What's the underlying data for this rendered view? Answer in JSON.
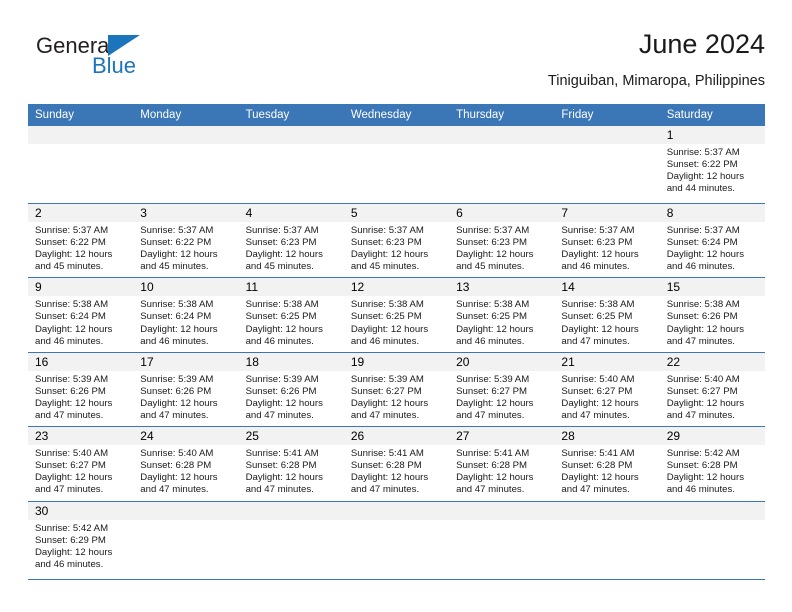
{
  "brand": {
    "name_part1": "General",
    "name_part2": "Blue",
    "triangle_color": "#1b75bc"
  },
  "header": {
    "title": "June 2024",
    "subtitle": "Tiniguiban, Mimaropa, Philippines"
  },
  "theme": {
    "header_blue": "#3b76b6",
    "day_band_gray": "#f2f2f2",
    "text_black": "#1a1a1a"
  },
  "calendar": {
    "weekdays": [
      "Sunday",
      "Monday",
      "Tuesday",
      "Wednesday",
      "Thursday",
      "Friday",
      "Saturday"
    ],
    "weeks": [
      [
        {
          "day": "",
          "empty": true
        },
        {
          "day": "",
          "empty": true
        },
        {
          "day": "",
          "empty": true
        },
        {
          "day": "",
          "empty": true
        },
        {
          "day": "",
          "empty": true
        },
        {
          "day": "",
          "empty": true
        },
        {
          "day": "1",
          "sunrise": "Sunrise: 5:37 AM",
          "sunset": "Sunset: 6:22 PM",
          "daylight": "Daylight: 12 hours and 44 minutes."
        }
      ],
      [
        {
          "day": "2",
          "sunrise": "Sunrise: 5:37 AM",
          "sunset": "Sunset: 6:22 PM",
          "daylight": "Daylight: 12 hours and 45 minutes."
        },
        {
          "day": "3",
          "sunrise": "Sunrise: 5:37 AM",
          "sunset": "Sunset: 6:22 PM",
          "daylight": "Daylight: 12 hours and 45 minutes."
        },
        {
          "day": "4",
          "sunrise": "Sunrise: 5:37 AM",
          "sunset": "Sunset: 6:23 PM",
          "daylight": "Daylight: 12 hours and 45 minutes."
        },
        {
          "day": "5",
          "sunrise": "Sunrise: 5:37 AM",
          "sunset": "Sunset: 6:23 PM",
          "daylight": "Daylight: 12 hours and 45 minutes."
        },
        {
          "day": "6",
          "sunrise": "Sunrise: 5:37 AM",
          "sunset": "Sunset: 6:23 PM",
          "daylight": "Daylight: 12 hours and 45 minutes."
        },
        {
          "day": "7",
          "sunrise": "Sunrise: 5:37 AM",
          "sunset": "Sunset: 6:23 PM",
          "daylight": "Daylight: 12 hours and 46 minutes."
        },
        {
          "day": "8",
          "sunrise": "Sunrise: 5:37 AM",
          "sunset": "Sunset: 6:24 PM",
          "daylight": "Daylight: 12 hours and 46 minutes."
        }
      ],
      [
        {
          "day": "9",
          "sunrise": "Sunrise: 5:38 AM",
          "sunset": "Sunset: 6:24 PM",
          "daylight": "Daylight: 12 hours and 46 minutes."
        },
        {
          "day": "10",
          "sunrise": "Sunrise: 5:38 AM",
          "sunset": "Sunset: 6:24 PM",
          "daylight": "Daylight: 12 hours and 46 minutes."
        },
        {
          "day": "11",
          "sunrise": "Sunrise: 5:38 AM",
          "sunset": "Sunset: 6:25 PM",
          "daylight": "Daylight: 12 hours and 46 minutes."
        },
        {
          "day": "12",
          "sunrise": "Sunrise: 5:38 AM",
          "sunset": "Sunset: 6:25 PM",
          "daylight": "Daylight: 12 hours and 46 minutes."
        },
        {
          "day": "13",
          "sunrise": "Sunrise: 5:38 AM",
          "sunset": "Sunset: 6:25 PM",
          "daylight": "Daylight: 12 hours and 46 minutes."
        },
        {
          "day": "14",
          "sunrise": "Sunrise: 5:38 AM",
          "sunset": "Sunset: 6:25 PM",
          "daylight": "Daylight: 12 hours and 47 minutes."
        },
        {
          "day": "15",
          "sunrise": "Sunrise: 5:38 AM",
          "sunset": "Sunset: 6:26 PM",
          "daylight": "Daylight: 12 hours and 47 minutes."
        }
      ],
      [
        {
          "day": "16",
          "sunrise": "Sunrise: 5:39 AM",
          "sunset": "Sunset: 6:26 PM",
          "daylight": "Daylight: 12 hours and 47 minutes."
        },
        {
          "day": "17",
          "sunrise": "Sunrise: 5:39 AM",
          "sunset": "Sunset: 6:26 PM",
          "daylight": "Daylight: 12 hours and 47 minutes."
        },
        {
          "day": "18",
          "sunrise": "Sunrise: 5:39 AM",
          "sunset": "Sunset: 6:26 PM",
          "daylight": "Daylight: 12 hours and 47 minutes."
        },
        {
          "day": "19",
          "sunrise": "Sunrise: 5:39 AM",
          "sunset": "Sunset: 6:27 PM",
          "daylight": "Daylight: 12 hours and 47 minutes."
        },
        {
          "day": "20",
          "sunrise": "Sunrise: 5:39 AM",
          "sunset": "Sunset: 6:27 PM",
          "daylight": "Daylight: 12 hours and 47 minutes."
        },
        {
          "day": "21",
          "sunrise": "Sunrise: 5:40 AM",
          "sunset": "Sunset: 6:27 PM",
          "daylight": "Daylight: 12 hours and 47 minutes."
        },
        {
          "day": "22",
          "sunrise": "Sunrise: 5:40 AM",
          "sunset": "Sunset: 6:27 PM",
          "daylight": "Daylight: 12 hours and 47 minutes."
        }
      ],
      [
        {
          "day": "23",
          "sunrise": "Sunrise: 5:40 AM",
          "sunset": "Sunset: 6:27 PM",
          "daylight": "Daylight: 12 hours and 47 minutes."
        },
        {
          "day": "24",
          "sunrise": "Sunrise: 5:40 AM",
          "sunset": "Sunset: 6:28 PM",
          "daylight": "Daylight: 12 hours and 47 minutes."
        },
        {
          "day": "25",
          "sunrise": "Sunrise: 5:41 AM",
          "sunset": "Sunset: 6:28 PM",
          "daylight": "Daylight: 12 hours and 47 minutes."
        },
        {
          "day": "26",
          "sunrise": "Sunrise: 5:41 AM",
          "sunset": "Sunset: 6:28 PM",
          "daylight": "Daylight: 12 hours and 47 minutes."
        },
        {
          "day": "27",
          "sunrise": "Sunrise: 5:41 AM",
          "sunset": "Sunset: 6:28 PM",
          "daylight": "Daylight: 12 hours and 47 minutes."
        },
        {
          "day": "28",
          "sunrise": "Sunrise: 5:41 AM",
          "sunset": "Sunset: 6:28 PM",
          "daylight": "Daylight: 12 hours and 47 minutes."
        },
        {
          "day": "29",
          "sunrise": "Sunrise: 5:42 AM",
          "sunset": "Sunset: 6:28 PM",
          "daylight": "Daylight: 12 hours and 46 minutes."
        }
      ],
      [
        {
          "day": "30",
          "sunrise": "Sunrise: 5:42 AM",
          "sunset": "Sunset: 6:29 PM",
          "daylight": "Daylight: 12 hours and 46 minutes."
        },
        {
          "day": "",
          "empty": true
        },
        {
          "day": "",
          "empty": true
        },
        {
          "day": "",
          "empty": true
        },
        {
          "day": "",
          "empty": true
        },
        {
          "day": "",
          "empty": true
        },
        {
          "day": "",
          "empty": true
        }
      ]
    ]
  }
}
